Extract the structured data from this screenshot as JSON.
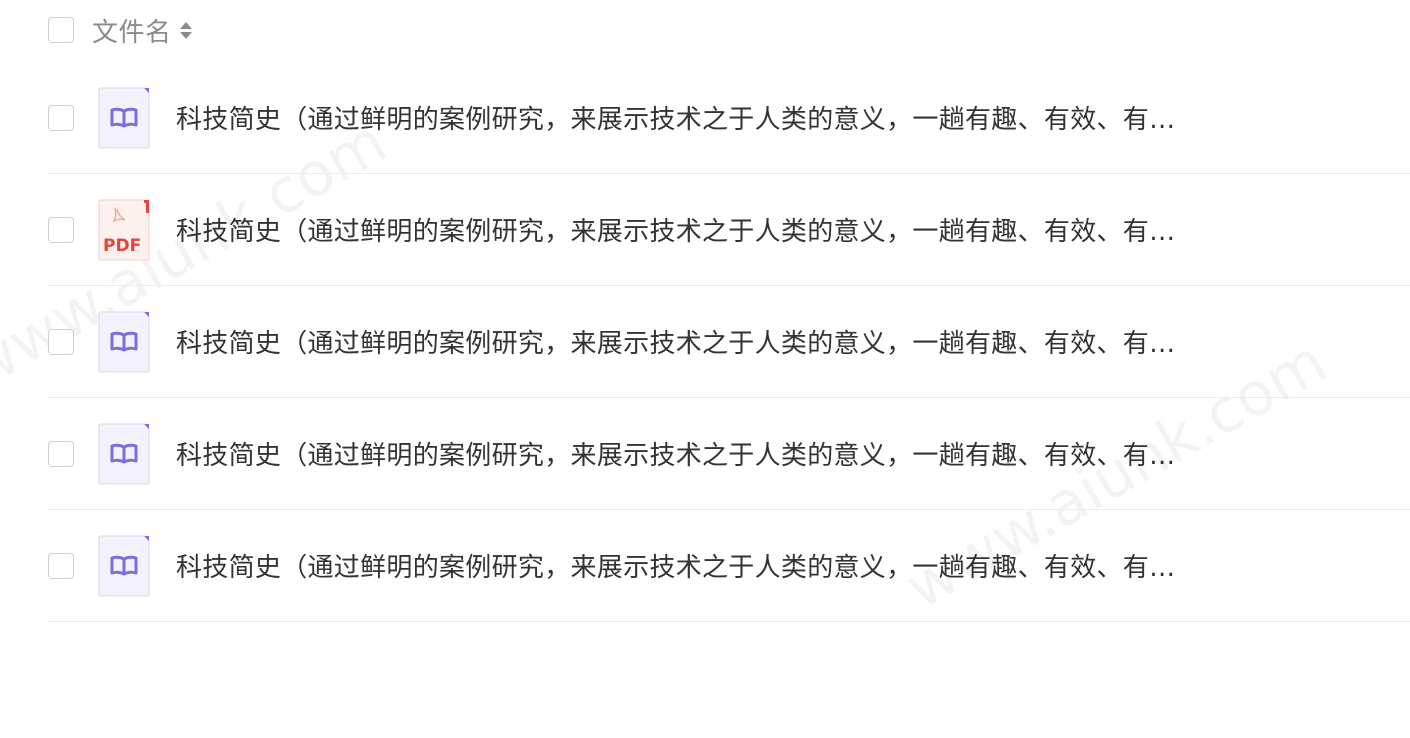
{
  "header": {
    "column_label": "文件名"
  },
  "rows": [
    {
      "type": "book",
      "name": "科技简史（通过鲜明的案例研究，来展示技术之于人类的意义，一趟有趣、有效、有…"
    },
    {
      "type": "pdf",
      "name": "科技简史（通过鲜明的案例研究，来展示技术之于人类的意义，一趟有趣、有效、有…",
      "badge": "PDF"
    },
    {
      "type": "book",
      "name": "科技简史（通过鲜明的案例研究，来展示技术之于人类的意义，一趟有趣、有效、有…"
    },
    {
      "type": "book",
      "name": "科技简史（通过鲜明的案例研究，来展示技术之于人类的意义，一趟有趣、有效、有…"
    },
    {
      "type": "book",
      "name": "科技简史（通过鲜明的案例研究，来展示技术之于人类的意义，一趟有趣、有效、有…"
    }
  ],
  "watermark": {
    "text": "www.aiunk.com"
  },
  "colors": {
    "book_icon_bg": "#f3f2fc",
    "book_icon_stroke": "#7b6fe0",
    "pdf_red": "#e0463b"
  }
}
